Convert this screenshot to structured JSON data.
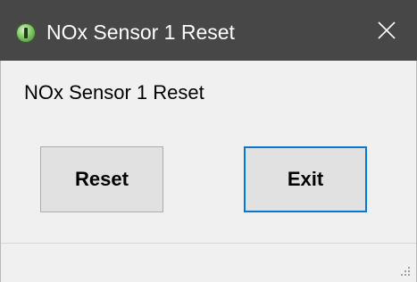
{
  "window": {
    "title": "NOx Sensor 1 Reset",
    "icon": "app-icon"
  },
  "dialog": {
    "message": "NOx Sensor 1 Reset",
    "reset_label": "Reset",
    "exit_label": "Exit"
  },
  "colors": {
    "titlebar": "#474747",
    "background": "#f0f0f0",
    "button": "#e1e1e1",
    "focus_border": "#0078d7"
  }
}
